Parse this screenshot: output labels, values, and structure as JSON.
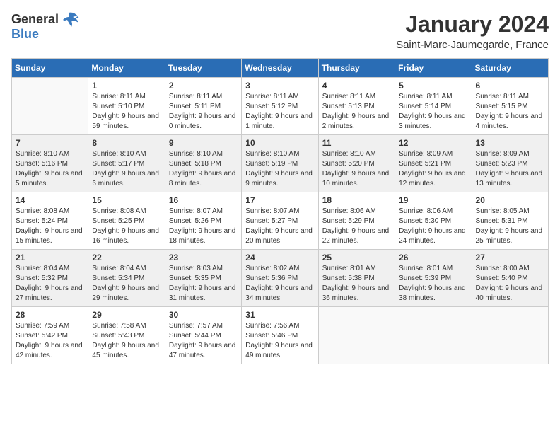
{
  "header": {
    "logo_general": "General",
    "logo_blue": "Blue",
    "month_title": "January 2024",
    "location": "Saint-Marc-Jaumegarde, France"
  },
  "days_of_week": [
    "Sunday",
    "Monday",
    "Tuesday",
    "Wednesday",
    "Thursday",
    "Friday",
    "Saturday"
  ],
  "weeks": [
    {
      "days": [
        {
          "num": "",
          "empty": true
        },
        {
          "num": "1",
          "sunrise": "Sunrise: 8:11 AM",
          "sunset": "Sunset: 5:10 PM",
          "daylight": "Daylight: 9 hours and 59 minutes."
        },
        {
          "num": "2",
          "sunrise": "Sunrise: 8:11 AM",
          "sunset": "Sunset: 5:11 PM",
          "daylight": "Daylight: 9 hours and 0 minutes."
        },
        {
          "num": "3",
          "sunrise": "Sunrise: 8:11 AM",
          "sunset": "Sunset: 5:12 PM",
          "daylight": "Daylight: 9 hours and 1 minute."
        },
        {
          "num": "4",
          "sunrise": "Sunrise: 8:11 AM",
          "sunset": "Sunset: 5:13 PM",
          "daylight": "Daylight: 9 hours and 2 minutes."
        },
        {
          "num": "5",
          "sunrise": "Sunrise: 8:11 AM",
          "sunset": "Sunset: 5:14 PM",
          "daylight": "Daylight: 9 hours and 3 minutes."
        },
        {
          "num": "6",
          "sunrise": "Sunrise: 8:11 AM",
          "sunset": "Sunset: 5:15 PM",
          "daylight": "Daylight: 9 hours and 4 minutes."
        }
      ]
    },
    {
      "days": [
        {
          "num": "7",
          "sunrise": "Sunrise: 8:10 AM",
          "sunset": "Sunset: 5:16 PM",
          "daylight": "Daylight: 9 hours and 5 minutes."
        },
        {
          "num": "8",
          "sunrise": "Sunrise: 8:10 AM",
          "sunset": "Sunset: 5:17 PM",
          "daylight": "Daylight: 9 hours and 6 minutes."
        },
        {
          "num": "9",
          "sunrise": "Sunrise: 8:10 AM",
          "sunset": "Sunset: 5:18 PM",
          "daylight": "Daylight: 9 hours and 8 minutes."
        },
        {
          "num": "10",
          "sunrise": "Sunrise: 8:10 AM",
          "sunset": "Sunset: 5:19 PM",
          "daylight": "Daylight: 9 hours and 9 minutes."
        },
        {
          "num": "11",
          "sunrise": "Sunrise: 8:10 AM",
          "sunset": "Sunset: 5:20 PM",
          "daylight": "Daylight: 9 hours and 10 minutes."
        },
        {
          "num": "12",
          "sunrise": "Sunrise: 8:09 AM",
          "sunset": "Sunset: 5:21 PM",
          "daylight": "Daylight: 9 hours and 12 minutes."
        },
        {
          "num": "13",
          "sunrise": "Sunrise: 8:09 AM",
          "sunset": "Sunset: 5:23 PM",
          "daylight": "Daylight: 9 hours and 13 minutes."
        }
      ]
    },
    {
      "days": [
        {
          "num": "14",
          "sunrise": "Sunrise: 8:08 AM",
          "sunset": "Sunset: 5:24 PM",
          "daylight": "Daylight: 9 hours and 15 minutes."
        },
        {
          "num": "15",
          "sunrise": "Sunrise: 8:08 AM",
          "sunset": "Sunset: 5:25 PM",
          "daylight": "Daylight: 9 hours and 16 minutes."
        },
        {
          "num": "16",
          "sunrise": "Sunrise: 8:07 AM",
          "sunset": "Sunset: 5:26 PM",
          "daylight": "Daylight: 9 hours and 18 minutes."
        },
        {
          "num": "17",
          "sunrise": "Sunrise: 8:07 AM",
          "sunset": "Sunset: 5:27 PM",
          "daylight": "Daylight: 9 hours and 20 minutes."
        },
        {
          "num": "18",
          "sunrise": "Sunrise: 8:06 AM",
          "sunset": "Sunset: 5:29 PM",
          "daylight": "Daylight: 9 hours and 22 minutes."
        },
        {
          "num": "19",
          "sunrise": "Sunrise: 8:06 AM",
          "sunset": "Sunset: 5:30 PM",
          "daylight": "Daylight: 9 hours and 24 minutes."
        },
        {
          "num": "20",
          "sunrise": "Sunrise: 8:05 AM",
          "sunset": "Sunset: 5:31 PM",
          "daylight": "Daylight: 9 hours and 25 minutes."
        }
      ]
    },
    {
      "days": [
        {
          "num": "21",
          "sunrise": "Sunrise: 8:04 AM",
          "sunset": "Sunset: 5:32 PM",
          "daylight": "Daylight: 9 hours and 27 minutes."
        },
        {
          "num": "22",
          "sunrise": "Sunrise: 8:04 AM",
          "sunset": "Sunset: 5:34 PM",
          "daylight": "Daylight: 9 hours and 29 minutes."
        },
        {
          "num": "23",
          "sunrise": "Sunrise: 8:03 AM",
          "sunset": "Sunset: 5:35 PM",
          "daylight": "Daylight: 9 hours and 31 minutes."
        },
        {
          "num": "24",
          "sunrise": "Sunrise: 8:02 AM",
          "sunset": "Sunset: 5:36 PM",
          "daylight": "Daylight: 9 hours and 34 minutes."
        },
        {
          "num": "25",
          "sunrise": "Sunrise: 8:01 AM",
          "sunset": "Sunset: 5:38 PM",
          "daylight": "Daylight: 9 hours and 36 minutes."
        },
        {
          "num": "26",
          "sunrise": "Sunrise: 8:01 AM",
          "sunset": "Sunset: 5:39 PM",
          "daylight": "Daylight: 9 hours and 38 minutes."
        },
        {
          "num": "27",
          "sunrise": "Sunrise: 8:00 AM",
          "sunset": "Sunset: 5:40 PM",
          "daylight": "Daylight: 9 hours and 40 minutes."
        }
      ]
    },
    {
      "days": [
        {
          "num": "28",
          "sunrise": "Sunrise: 7:59 AM",
          "sunset": "Sunset: 5:42 PM",
          "daylight": "Daylight: 9 hours and 42 minutes."
        },
        {
          "num": "29",
          "sunrise": "Sunrise: 7:58 AM",
          "sunset": "Sunset: 5:43 PM",
          "daylight": "Daylight: 9 hours and 45 minutes."
        },
        {
          "num": "30",
          "sunrise": "Sunrise: 7:57 AM",
          "sunset": "Sunset: 5:44 PM",
          "daylight": "Daylight: 9 hours and 47 minutes."
        },
        {
          "num": "31",
          "sunrise": "Sunrise: 7:56 AM",
          "sunset": "Sunset: 5:46 PM",
          "daylight": "Daylight: 9 hours and 49 minutes."
        },
        {
          "num": "",
          "empty": true
        },
        {
          "num": "",
          "empty": true
        },
        {
          "num": "",
          "empty": true
        }
      ]
    }
  ]
}
